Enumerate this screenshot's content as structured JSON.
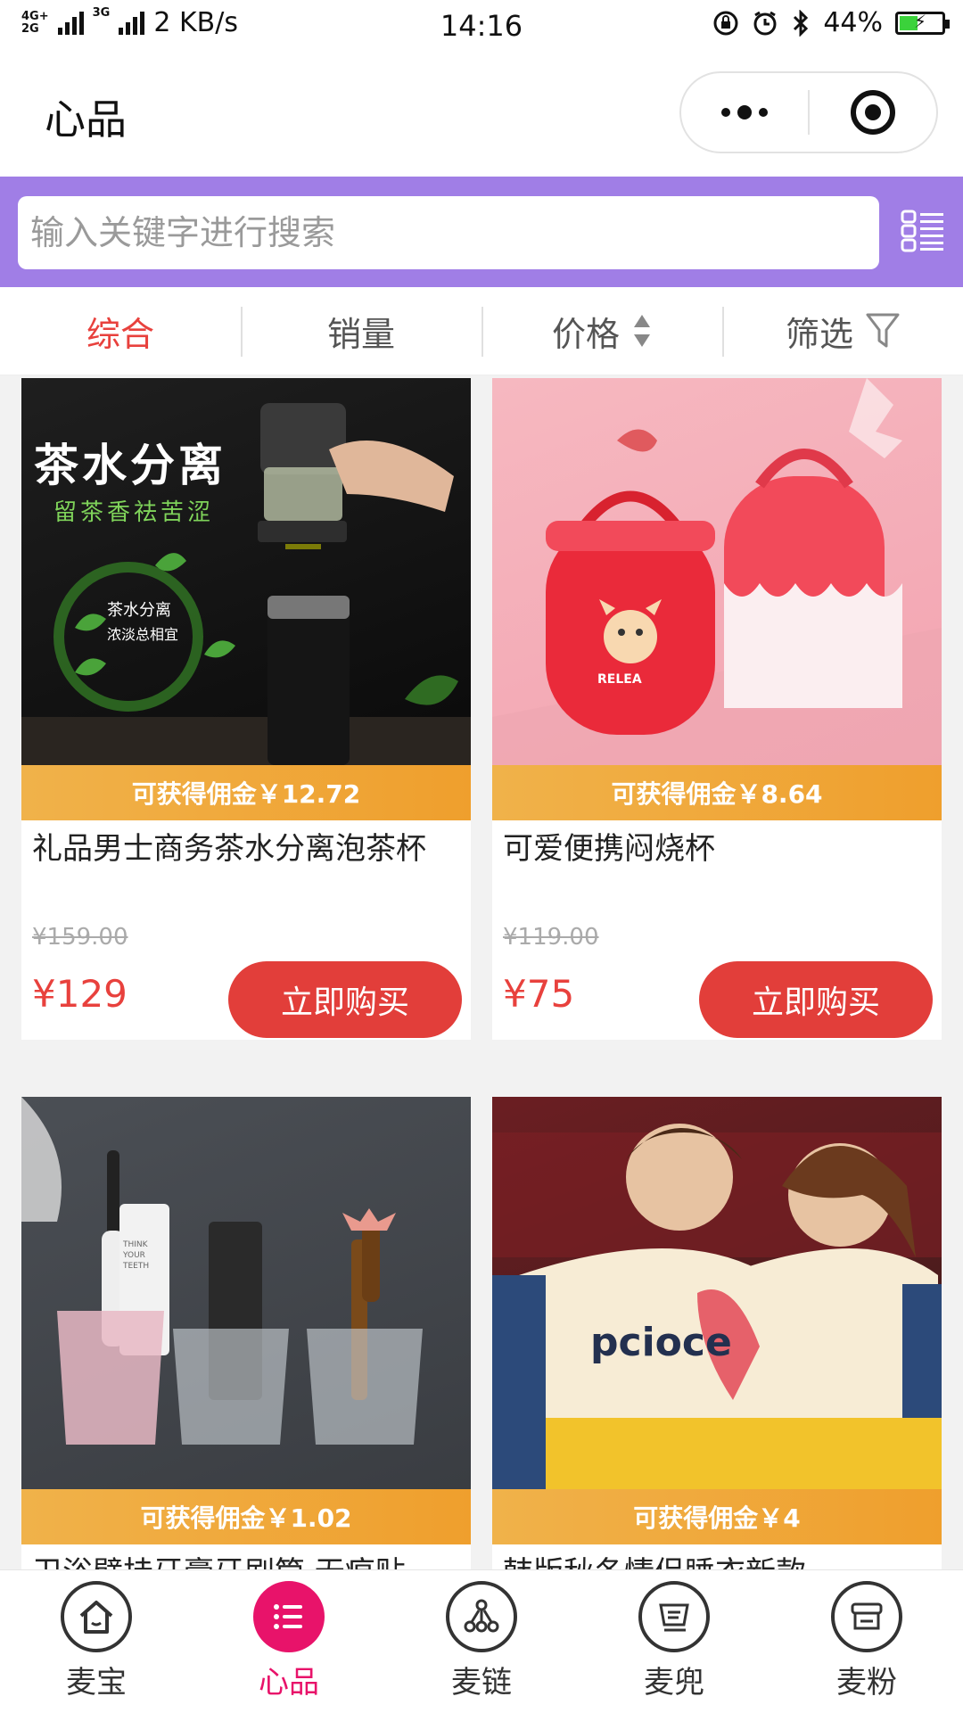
{
  "status_bar": {
    "network_top": "4G+",
    "network_bottom": "2G",
    "network_3g": "3G",
    "speed": "2 KB/s",
    "time": "14:16",
    "battery": "44%",
    "battery_level": 0.44
  },
  "nav": {
    "title": "心品"
  },
  "search": {
    "placeholder": "输入关键字进行搜索"
  },
  "sort": {
    "items": [
      {
        "label": "综合"
      },
      {
        "label": "销量"
      },
      {
        "label": "价格"
      },
      {
        "label": "筛选"
      }
    ]
  },
  "products": [
    {
      "commission": "可获得佣金￥12.72",
      "title": "礼品男士商务茶水分离泡茶杯",
      "old_price": "¥159.00",
      "price": "¥129",
      "buy_label": "立即购买",
      "img_text": "茶水分离",
      "img_sub": "留茶香祛苦涩",
      "img_badge1": "茶水分离",
      "img_badge2": "浓淡总相宜"
    },
    {
      "commission": "可获得佣金￥8.64",
      "title": "可爱便携闷烧杯",
      "old_price": "¥119.00",
      "price": "¥75",
      "buy_label": "立即购买",
      "img_text": "RELEA"
    },
    {
      "commission": "可获得佣金￥1.02",
      "title": "卫浴壁挂牙膏牙刷筒 无痕贴",
      "img_text": "THINK YOUR TEETH"
    },
    {
      "commission": "可获得佣金￥4",
      "title": "韩版秋冬情侣睡衣新款",
      "img_text": "pcioce"
    }
  ],
  "tabs": [
    {
      "label": "麦宝"
    },
    {
      "label": "心品"
    },
    {
      "label": "麦链"
    },
    {
      "label": "麦兜"
    },
    {
      "label": "麦粉"
    }
  ],
  "colors": {
    "search_bar": "#a07ee6",
    "accent_red": "#e8413d",
    "tab_active": "#e8136a",
    "commission_bar": "#f0b24a"
  }
}
